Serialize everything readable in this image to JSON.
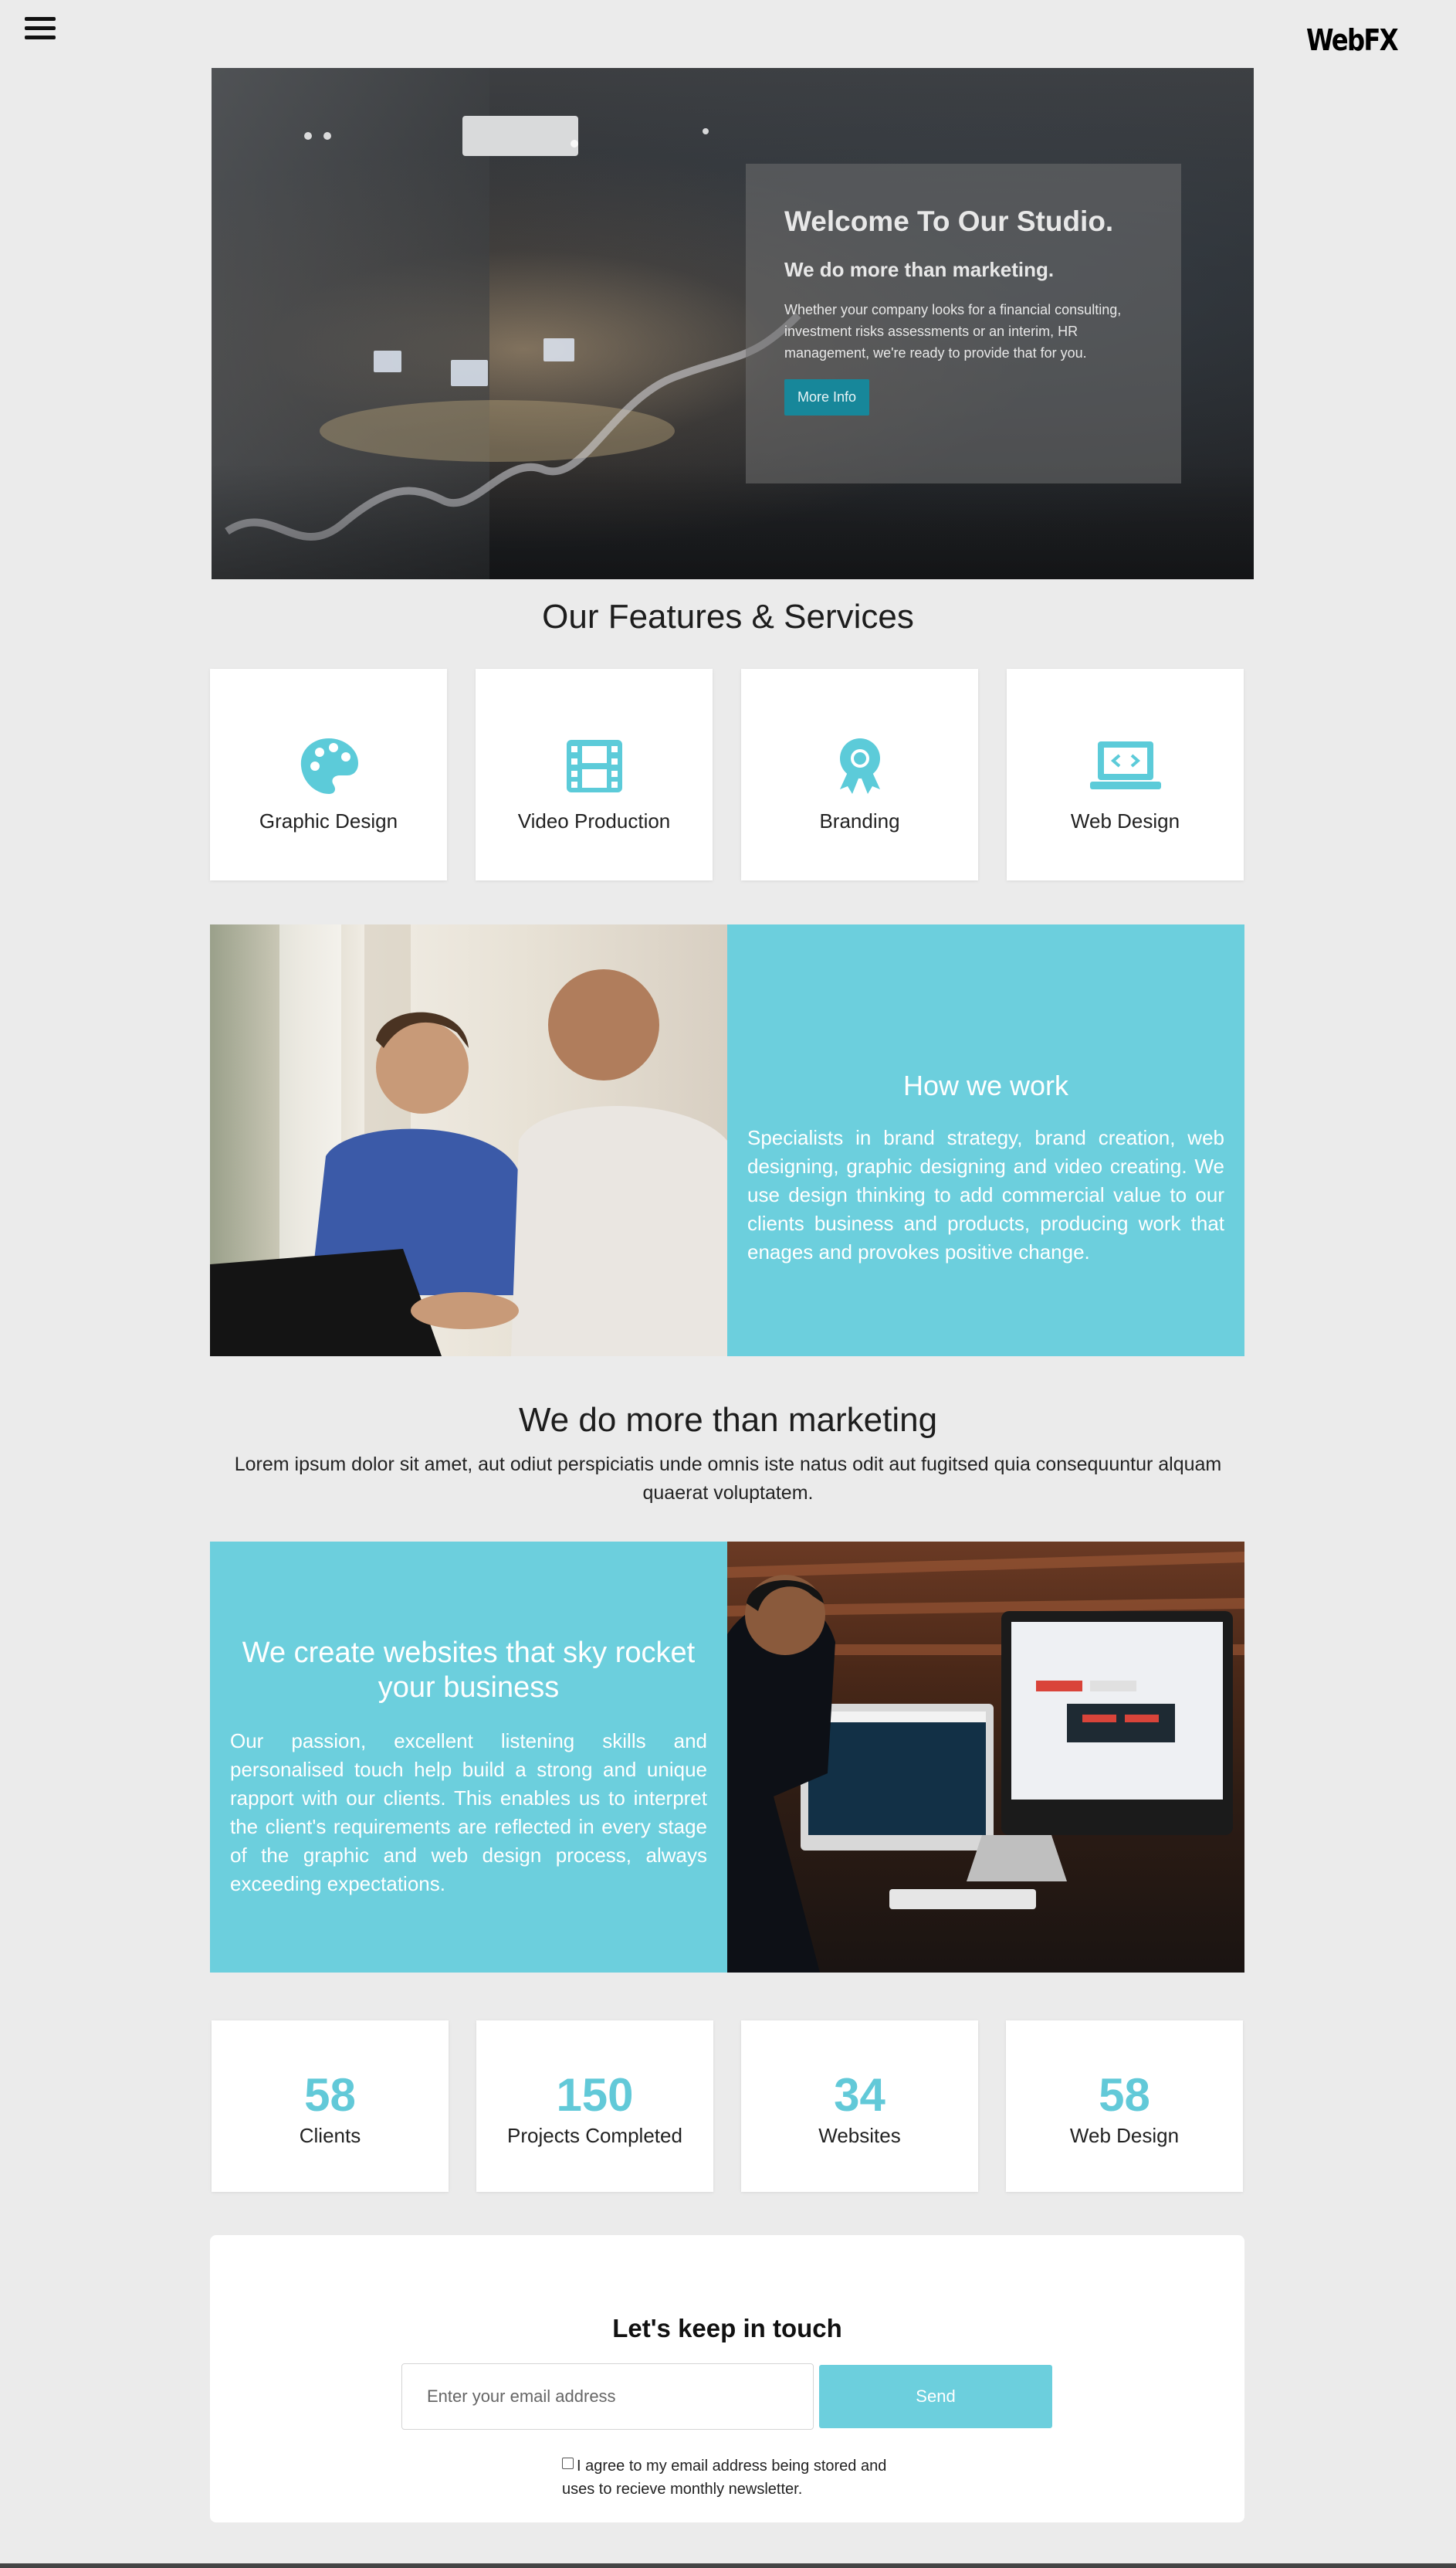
{
  "header": {
    "menu_icon": "hamburger-menu-icon",
    "logo": "WebFX"
  },
  "hero": {
    "title": "Welcome To Our Studio.",
    "subtitle": "We do more than marketing.",
    "text": "Whether your company looks for a financial consulting, investment risks assessments or an interim, HR management, we're ready to provide that for you.",
    "button_label": "More Info"
  },
  "features": {
    "title": "Our Features & Services",
    "items": [
      {
        "label": "Graphic Design",
        "icon": "palette-icon"
      },
      {
        "label": "Video Production",
        "icon": "film-icon"
      },
      {
        "label": "Branding",
        "icon": "award-icon"
      },
      {
        "label": "Web Design",
        "icon": "laptop-code-icon"
      }
    ],
    "accent_color": "#5ccbd9"
  },
  "how_we_work": {
    "title": "How we work",
    "text": "Specialists in brand strategy, brand creation, web designing, graphic designing and video creating. We use design thinking to add commercial value to our clients business and products, producing work that enages and provokes positive change."
  },
  "more": {
    "title": "We do more than marketing",
    "text": "Lorem ipsum dolor sit amet, aut odiut perspiciatis unde omnis iste natus odit aut fugitsed quia consequuntur alquam quaerat voluptatem."
  },
  "create": {
    "title": "We create websites that sky rocket your business",
    "text": "Our passion, excellent listening skills and personalised touch help build a strong and unique rapport with our clients. This enables us to interpret the client's requirements are reflected in every stage of the graphic and web design process, always exceeding expectations."
  },
  "stats": [
    {
      "number": "58",
      "label": "Clients"
    },
    {
      "number": "150",
      "label": "Projects Completed"
    },
    {
      "number": "34",
      "label": "Websites"
    },
    {
      "number": "58",
      "label": "Web Design"
    }
  ],
  "contact": {
    "title": "Let's keep in touch",
    "email_placeholder": "Enter your email address",
    "send_label": "Send",
    "agree_text": "I agree to my email address being stored and uses to recieve monthly newsletter."
  },
  "colors": {
    "panel": "#6ccfdd",
    "button_dark": "#17879a",
    "page_bg": "#ebebeb"
  }
}
